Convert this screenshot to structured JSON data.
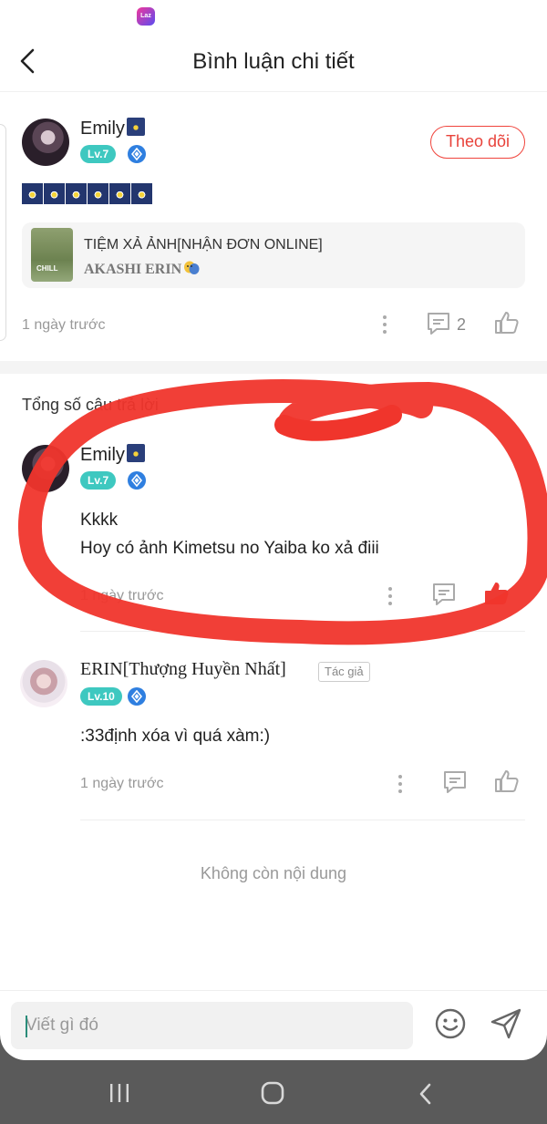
{
  "status_bar": {
    "app_indicator": "Laz"
  },
  "header": {
    "title": "Bình luận chi tiết"
  },
  "main_comment": {
    "user_name": "Emily",
    "level": "Lv.7",
    "follow_label": "Theo dõi",
    "shared_post": {
      "title": "TIỆM XẢ ẢNH[NHẬN ĐƠN ONLINE]",
      "author": "AKASHI ERIN",
      "thumbnail_text": "CHILL"
    },
    "timestamp": "1 ngày trước",
    "reply_count": "2"
  },
  "replies_total": "Tổng số câu trả lời",
  "replies": [
    {
      "user_name": "Emily",
      "level": "Lv.7",
      "text_lines": [
        "Kkkk",
        "Hoy có ảnh Kimetsu no Yaiba ko xả điii"
      ],
      "timestamp": "1 ngày trước",
      "liked": true
    },
    {
      "user_name": "ERIN[Thượng Huyền Nhất]",
      "author_tag": "Tác giả",
      "level": "Lv.10",
      "text": ":33định xóa vì quá xàm:)",
      "timestamp": "1 ngày trước",
      "liked": false
    }
  ],
  "end_message": "Không còn nội dung",
  "input": {
    "placeholder": "Viết gì đó"
  },
  "colors": {
    "accent_red": "#e8423a",
    "level_teal": "#3ec8c0",
    "gem_blue": "#2f7fe0",
    "annotation_red": "#f0352c"
  }
}
